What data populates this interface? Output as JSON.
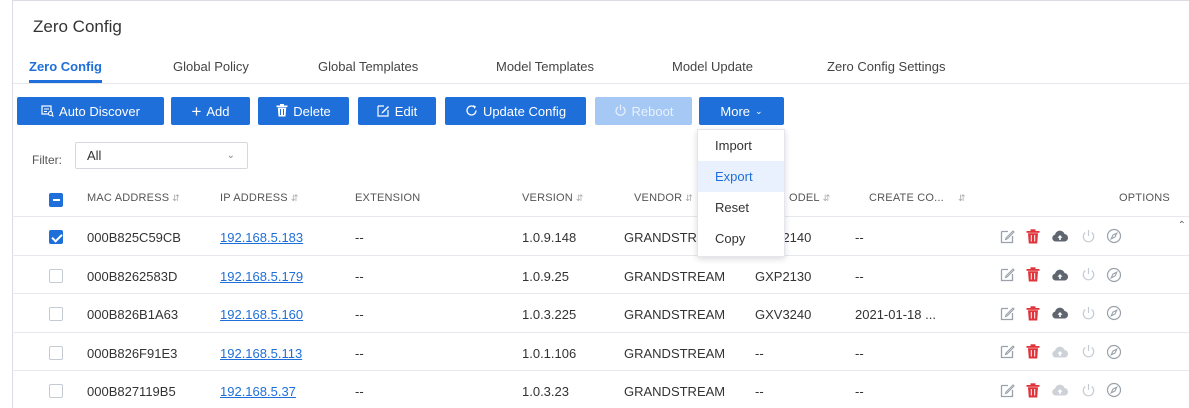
{
  "page_title": "Zero Config",
  "tabs": [
    {
      "label": "Zero Config",
      "active": true
    },
    {
      "label": "Global Policy",
      "active": false
    },
    {
      "label": "Global Templates",
      "active": false
    },
    {
      "label": "Model Templates",
      "active": false
    },
    {
      "label": "Model Update",
      "active": false
    },
    {
      "label": "Zero Config Settings",
      "active": false
    }
  ],
  "toolbar": {
    "auto_discover": "Auto Discover",
    "add": "Add",
    "delete": "Delete",
    "edit": "Edit",
    "update_config": "Update Config",
    "reboot": "Reboot",
    "more": "More"
  },
  "more_menu": {
    "items": [
      "Import",
      "Export",
      "Reset",
      "Copy"
    ],
    "hovered": "Export"
  },
  "filter": {
    "label": "Filter:",
    "value": "All"
  },
  "table": {
    "headers": {
      "mac": "MAC ADDRESS",
      "ip": "IP ADDRESS",
      "extension": "EXTENSION",
      "version": "VERSION",
      "vendor": "VENDOR",
      "model": "ODEL",
      "create": "CREATE CO...",
      "options": "OPTIONS"
    },
    "rows": [
      {
        "checked": true,
        "mac": "000B825C59CB",
        "ip": "192.168.5.183",
        "extension": "--",
        "version": "1.0.9.148",
        "vendor": "GRANDSTREAM",
        "model": "GXP2140",
        "created": "--",
        "cloud_active": true
      },
      {
        "checked": false,
        "mac": "000B8262583D",
        "ip": "192.168.5.179",
        "extension": "--",
        "version": "1.0.9.25",
        "vendor": "GRANDSTREAM",
        "model": "GXP2130",
        "created": "--",
        "cloud_active": true
      },
      {
        "checked": false,
        "mac": "000B826B1A63",
        "ip": "192.168.5.160",
        "extension": "--",
        "version": "1.0.3.225",
        "vendor": "GRANDSTREAM",
        "model": "GXV3240",
        "created": "2021-01-18 ...",
        "cloud_active": true
      },
      {
        "checked": false,
        "mac": "000B826F91E3",
        "ip": "192.168.5.113",
        "extension": "--",
        "version": "1.0.1.106",
        "vendor": "GRANDSTREAM",
        "model": "--",
        "created": "--",
        "cloud_active": false
      },
      {
        "checked": false,
        "mac": "000B827119B5",
        "ip": "192.168.5.37",
        "extension": "--",
        "version": "1.0.3.23",
        "vendor": "GRANDSTREAM",
        "model": "--",
        "created": "--",
        "cloud_active": false
      }
    ]
  },
  "icons": {
    "edit": "edit-icon",
    "delete": "trash-icon",
    "cloud": "cloud-upload-icon",
    "power": "power-icon",
    "compass": "compass-icon"
  },
  "colors": {
    "primary": "#1e6fd9",
    "primary_disabled": "#a5c8f4",
    "delete_red": "#e0343b",
    "icon_gray": "#9aa1aa",
    "cloud_dark": "#5f6670",
    "cloud_light": "#cdd2d8"
  }
}
